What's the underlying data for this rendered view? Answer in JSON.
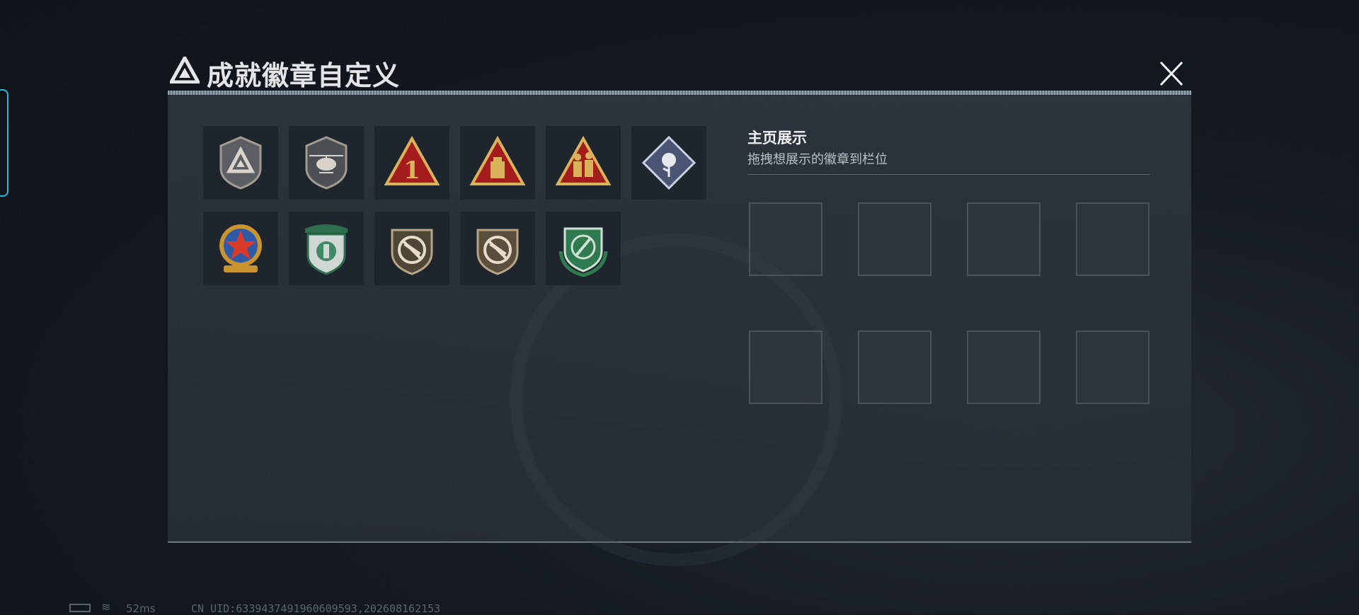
{
  "window": {
    "title": "成就徽章自定义",
    "close_label": "×"
  },
  "badges": [
    {
      "name": "triangle-shield-badge",
      "row": 0,
      "col": 0,
      "color": "#8f8a80"
    },
    {
      "name": "helicopter-shield-badge",
      "row": 0,
      "col": 1,
      "color": "#8f8a80"
    },
    {
      "name": "number-one-triangle-badge",
      "row": 0,
      "col": 2,
      "color": "#b01e1e"
    },
    {
      "name": "package-triangle-badge",
      "row": 0,
      "col": 3,
      "color": "#b01e1e"
    },
    {
      "name": "soldiers-triangle-badge",
      "row": 0,
      "col": 4,
      "color": "#b01e1e"
    },
    {
      "name": "rose-diamond-badge",
      "row": 0,
      "col": 5,
      "color": "#6d78a0"
    },
    {
      "name": "star-medal-badge",
      "row": 1,
      "col": 0,
      "color": "#2e5aa8"
    },
    {
      "name": "green-shield-badge",
      "row": 1,
      "col": 1,
      "color": "#3f8a67"
    },
    {
      "name": "rifle-shield-badge",
      "row": 1,
      "col": 2,
      "color": "#8a7860"
    },
    {
      "name": "rifle-shield-badge-2",
      "row": 1,
      "col": 3,
      "color": "#8a7860"
    },
    {
      "name": "green-knife-shield-badge",
      "row": 1,
      "col": 4,
      "color": "#2f7a4f"
    }
  ],
  "showcase": {
    "title": "主页展示",
    "subtitle": "拖拽想展示的徽章到栏位",
    "slots": 8
  },
  "status": {
    "ping": "52ms",
    "uid": "CN UID:6339437491960609593,202608162153"
  },
  "colors": {
    "gold": "#d9b25a",
    "panel": "#2e353e",
    "accent": "#2fb6d8"
  }
}
